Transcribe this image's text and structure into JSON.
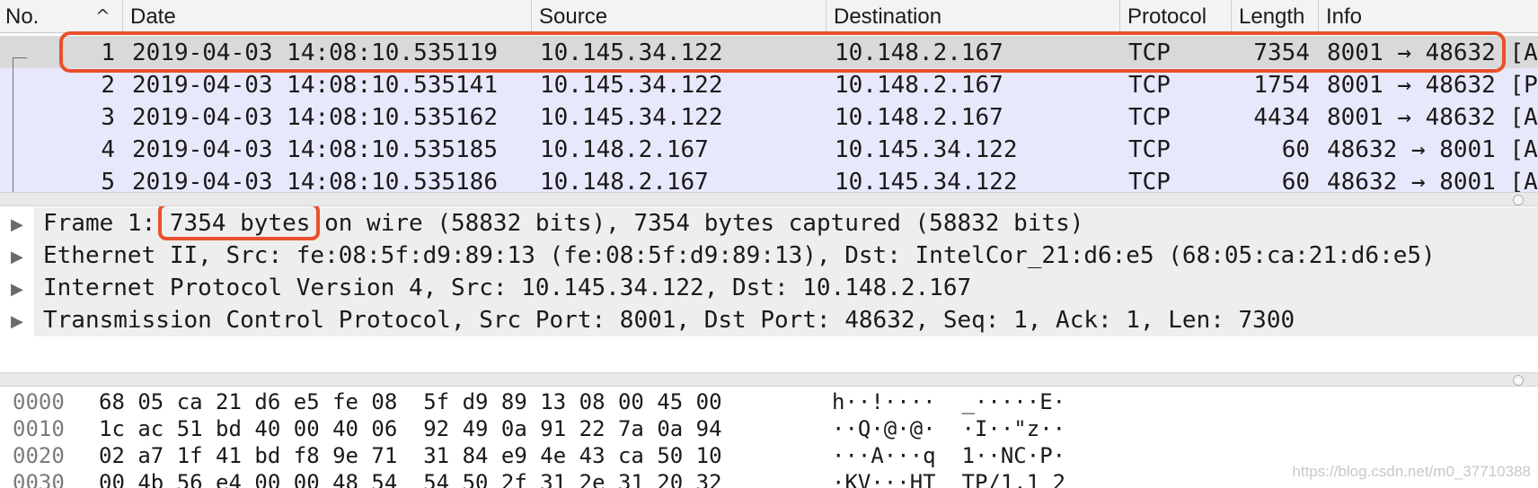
{
  "packet_list": {
    "columns": {
      "no": "No.",
      "date": "Date",
      "source": "Source",
      "destination": "Destination",
      "protocol": "Protocol",
      "length": "Length",
      "info": "Info"
    },
    "sort_icon": "chevron-up-icon",
    "rows": [
      {
        "no": "1",
        "date": "2019-04-03 14:08:10.535119",
        "source": "10.145.34.122",
        "destination": "10.148.2.167",
        "protocol": "TCP",
        "length": "7354",
        "info": "8001 → 48632 [A"
      },
      {
        "no": "2",
        "date": "2019-04-03 14:08:10.535141",
        "source": "10.145.34.122",
        "destination": "10.148.2.167",
        "protocol": "TCP",
        "length": "1754",
        "info": "8001 → 48632 [P"
      },
      {
        "no": "3",
        "date": "2019-04-03 14:08:10.535162",
        "source": "10.145.34.122",
        "destination": "10.148.2.167",
        "protocol": "TCP",
        "length": "4434",
        "info": "8001 → 48632 [A"
      },
      {
        "no": "4",
        "date": "2019-04-03 14:08:10.535185",
        "source": "10.148.2.167",
        "destination": "10.145.34.122",
        "protocol": "TCP",
        "length": "60",
        "info": "48632 → 8001 [A"
      },
      {
        "no": "5",
        "date": "2019-04-03 14:08:10.535186",
        "source": "10.148.2.167",
        "destination": "10.145.34.122",
        "protocol": "TCP",
        "length": "60",
        "info": "48632 → 8001 [A"
      }
    ]
  },
  "details": {
    "frame": {
      "prefix": "Frame 1: ",
      "bytes": "7354 bytes",
      "suffix": " on wire (58832 bits), 7354 bytes captured (58832 bits)"
    },
    "ethernet": "Ethernet II, Src: fe:08:5f:d9:89:13 (fe:08:5f:d9:89:13), Dst: IntelCor_21:d6:e5 (68:05:ca:21:d6:e5)",
    "ip": "Internet Protocol Version 4, Src: 10.145.34.122, Dst: 10.148.2.167",
    "tcp": "Transmission Control Protocol, Src Port: 8001, Dst Port: 48632, Seq: 1, Ack: 1, Len: 7300"
  },
  "hex": [
    {
      "offset": "0000",
      "bytes": "68 05 ca 21 d6 e5 fe 08  5f d9 89 13 08 00 45 00",
      "ascii": "h··!····  _·····E·"
    },
    {
      "offset": "0010",
      "bytes": "1c ac 51 bd 40 00 40 06  92 49 0a 91 22 7a 0a 94",
      "ascii": "··Q·@·@·  ·I··\"z··"
    },
    {
      "offset": "0020",
      "bytes": "02 a7 1f 41 bd f8 9e 71  31 84 e9 4e 43 ca 50 10",
      "ascii": "···A···q  1··NC·P·"
    },
    {
      "offset": "0030",
      "bytes": "00 4b 56 e4 00 00 48 54  54 50 2f 31 2e 31 20 32",
      "ascii": "·KV···HT  TP/1.1 2"
    }
  ],
  "watermark": "https://blog.csdn.net/m0_37710388",
  "colors": {
    "highlight": "#e8512c",
    "row_bg": "#e8e8fc",
    "selected_bg": "#d9d9d9"
  }
}
